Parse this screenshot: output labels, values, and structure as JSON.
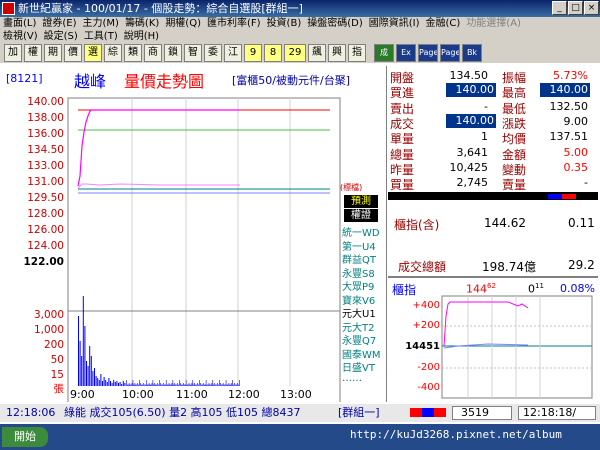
{
  "window": {
    "title": "新世紀贏家 - 100/01/17 - 個股走勢：綜合自選股[群組一]",
    "min": "_",
    "max": "□",
    "close": "×"
  },
  "menu1": [
    "畫面(L)",
    "證券(E)",
    "主力(M)",
    "籌碼(K)",
    "期權(Q)",
    "匯市利率(F)",
    "投資(B)",
    "操盤密碼(D)",
    "國際資訊(I)",
    "金融(C)",
    "功能選擇(A)"
  ],
  "menu1_disabled": "功能選擇(A)",
  "menu2": [
    "檢視(V)",
    "設定(S)",
    "工具(T)",
    "說明(H)"
  ],
  "toolbar": {
    "buttons": [
      "加",
      "權",
      "期",
      "價",
      "選",
      "綜",
      "類",
      "商",
      "鎖",
      "智",
      "委",
      "江",
      "9",
      "8",
      "29",
      "飆",
      "興",
      "指"
    ],
    "icons": [
      "成",
      "Ex",
      "Page",
      "Page",
      "Bk"
    ]
  },
  "stock": {
    "code": "[8121]",
    "name": "越峰",
    "chart_title": "量價走勢圖",
    "source": "[富櫃50/被動元件/台聚]"
  },
  "price_axis": [
    "140.00",
    "138.00",
    "136.00",
    "134.50",
    "133.00",
    "131.00",
    "129.50",
    "128.00",
    "126.00",
    "124.00",
    "122.00"
  ],
  "volume_axis": [
    "3,000",
    "1,000",
    "200",
    "50",
    "15",
    "張"
  ],
  "time_axis": [
    "9:00",
    "10:00",
    "11:00",
    "12:00",
    "13:00"
  ],
  "side_labels": {
    "predict": "預測",
    "warrant": "權證",
    "list": [
      "統一WD",
      "第一U4",
      "群益QT",
      "永豐S8",
      "大眾P9",
      "寶來V6",
      "元大U1",
      "元大T2",
      "永豐Q7",
      "國泰WM",
      "日盛VT",
      "……"
    ],
    "note": "(標檔)"
  },
  "quote": {
    "open_l": "開盤",
    "open_v": "134.50",
    "amp_l": "振幅",
    "amp_v": "5.73%",
    "buy_l": "買進",
    "buy_v": "140.00",
    "high_l": "最高",
    "high_v": "140.00",
    "sell_l": "賣出",
    "sell_v": "-",
    "low_l": "最低",
    "low_v": "132.50",
    "deal_l": "成交",
    "deal_v": "140.00",
    "chg_l": "漲跌",
    "chg_v": "9.00",
    "unit_l": "單量",
    "unit_v": "1",
    "avg_l": "均價",
    "avg_v": "137.51",
    "tvol_l": "總量",
    "tvol_v": "3,641",
    "amt_l": "金額",
    "amt_v": "5.00",
    "yvol_l": "昨量",
    "yvol_v": "10,425",
    "var_l": "變動",
    "var_v": "0.35",
    "bvol_l": "買量",
    "bvol_v": "2,745",
    "svol_l": "賣量",
    "svol_v": "-"
  },
  "counter": {
    "index_l": "櫃指(含)",
    "index_v": "144.62",
    "index_c": "0.11",
    "total_l": "成交總額",
    "total_v": "198.74億",
    "total_c": "29.2",
    "mini_l": "櫃指",
    "mini_v": "144",
    "mini_vs": "62",
    "mini_c": "0",
    "mini_cs": "11",
    "mini_p": "0.08%",
    "mini_axis": [
      "+400",
      "+200",
      "14451",
      "-200",
      "-400"
    ]
  },
  "status": {
    "time": "12:18:06",
    "text": "綠能 成交105(6.50) 量2 高105 低105 總8437",
    "group": "[群組一]",
    "num": "3519",
    "clock": "12:18:18/"
  },
  "taskbar": {
    "start": "開始",
    "watermark": "http://kuJd3268.pixnet.net/album"
  },
  "colors": {
    "bg": "#ffffff",
    "price_line": "#ff00ff",
    "avg_line": "#00aaaa",
    "limit_up": "#ff0000"
  }
}
